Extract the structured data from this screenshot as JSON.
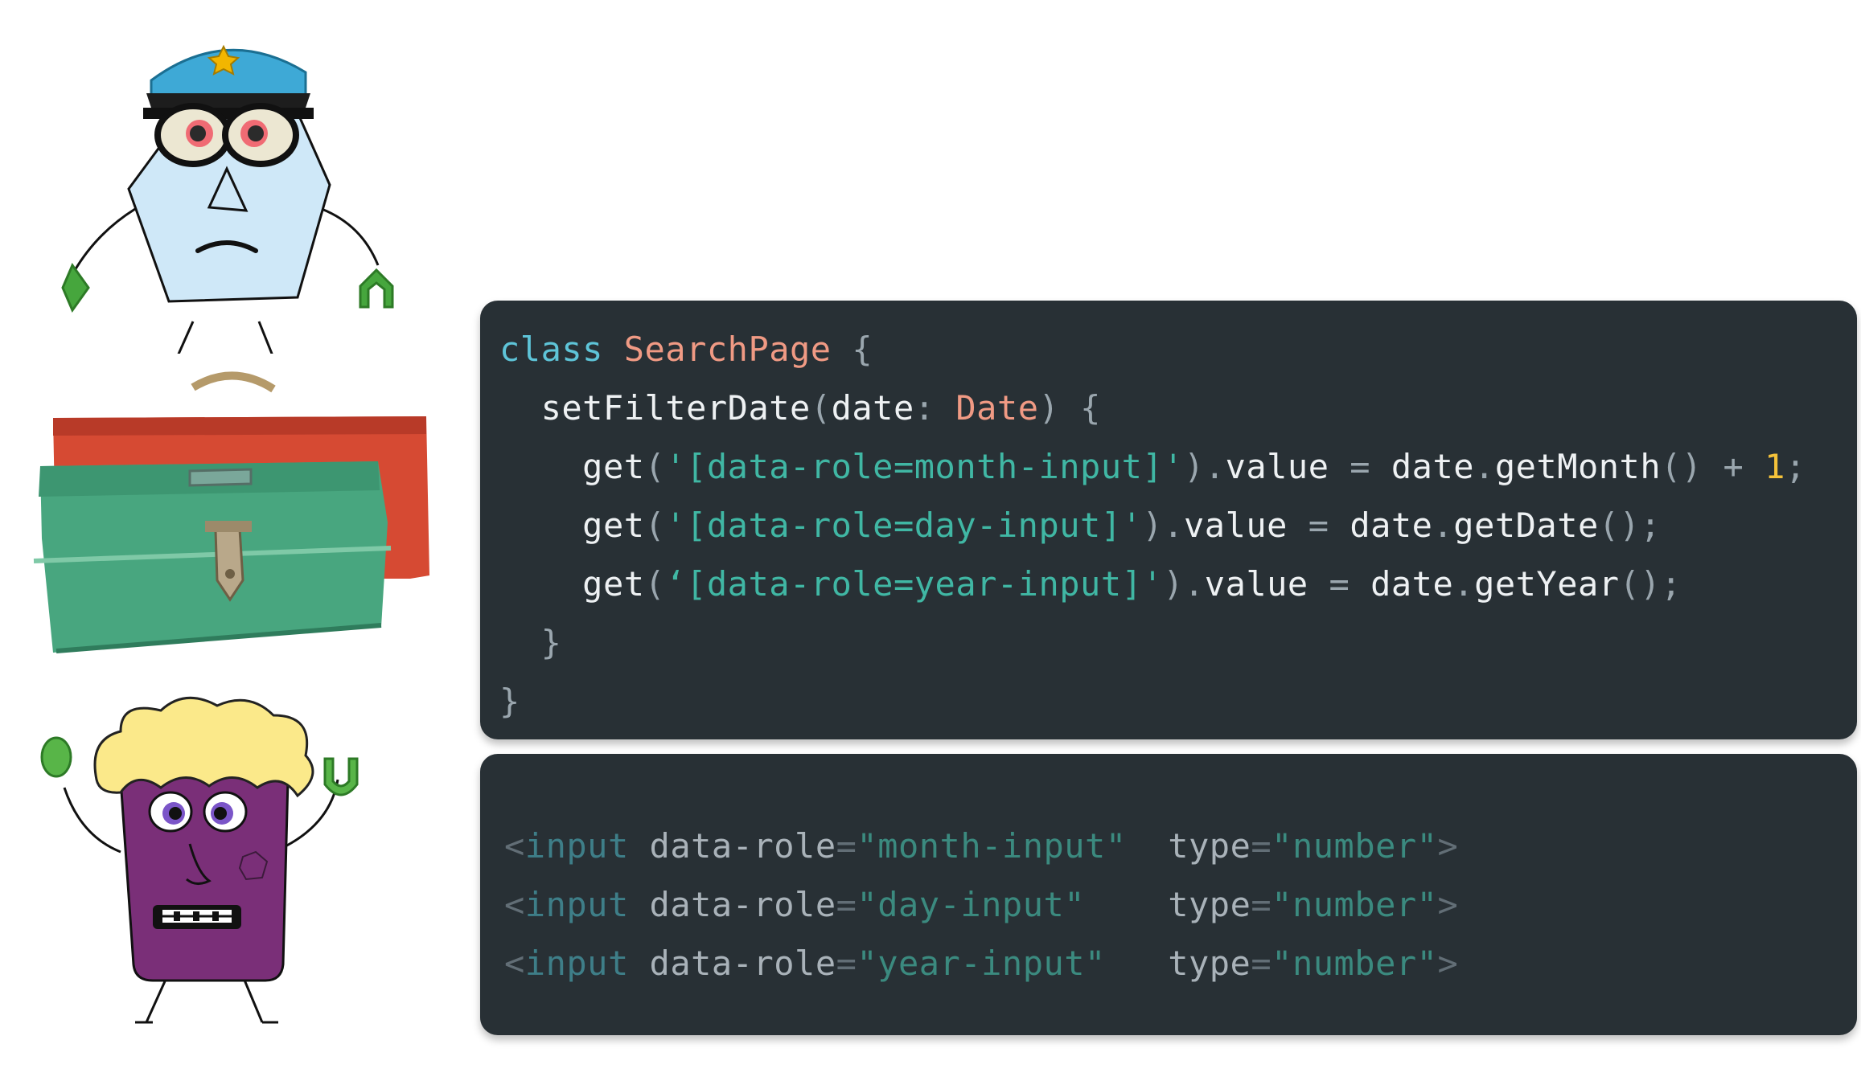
{
  "illustrations": {
    "cop_character": "cop-character",
    "toolbox": "toolbox",
    "monster_character": "monster-character"
  },
  "ts_code": {
    "l1": {
      "kw": "class",
      "cls": "SearchPage",
      "open": "{"
    },
    "l2": {
      "fn": "setFilterDate",
      "p1": "(",
      "arg": "date",
      "colon": ":",
      "type": "Date",
      "p2": ")",
      "open": "{"
    },
    "l3": {
      "get": "get",
      "p1": "(",
      "str": "'[data-role=month-input]'",
      "p2": ")",
      "dot1": ".",
      "prop": "value",
      "eq": "=",
      "obj": "date",
      "dot2": ".",
      "method": "getMonth",
      "call": "()",
      "plus": "+",
      "num": "1",
      "semi": ";"
    },
    "l4": {
      "get": "get",
      "p1": "(",
      "str": "'[data-role=day-input]'",
      "p2": ")",
      "dot1": ".",
      "prop": "value",
      "eq": "=",
      "obj": "date",
      "dot2": ".",
      "method": "getDate",
      "call": "();"
    },
    "l5": {
      "get": "get",
      "p1": "(",
      "str": "‘[data-role=year-input]'",
      "p2": ")",
      "dot1": ".",
      "prop": "value",
      "eq": "=",
      "obj": "date",
      "dot2": ".",
      "method": "getYear",
      "call": "();"
    },
    "l6": {
      "close": "}"
    },
    "l7": {
      "close": "}"
    }
  },
  "html_code": [
    {
      "lt": "<",
      "tag": "input",
      "attr1": "data-role",
      "eq1": "=",
      "val1": "\"month-input\"",
      "attr2": "type",
      "eq2": "=",
      "val2": "\"number\"",
      "gt": ">"
    },
    {
      "lt": "<",
      "tag": "input",
      "attr1": "data-role",
      "eq1": "=",
      "val1": "\"day-input\"",
      "attr2": "type",
      "eq2": "=",
      "val2": "\"number\"",
      "gt": ">"
    },
    {
      "lt": "<",
      "tag": "input",
      "attr1": "data-role",
      "eq1": "=",
      "val1": "\"year-input\"",
      "attr2": "type",
      "eq2": "=",
      "val2": "\"number\"",
      "gt": ">"
    }
  ],
  "colors": {
    "panel_bg": "#283035",
    "keyword": "#5ec4d8",
    "type": "#f09a84",
    "string": "#40b7a4",
    "number": "#f5c23a"
  }
}
